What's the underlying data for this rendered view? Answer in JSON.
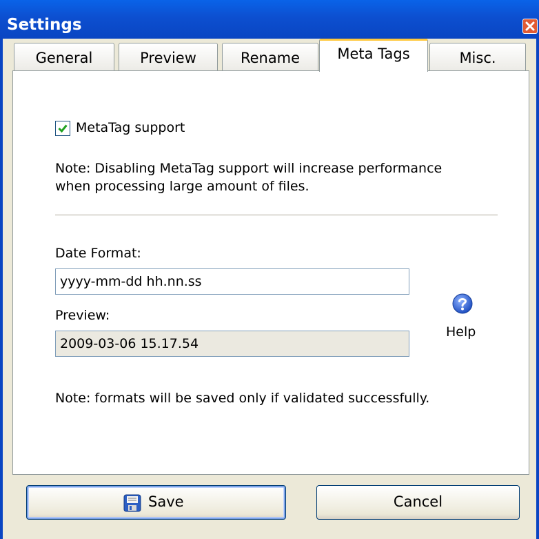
{
  "window": {
    "title": "Settings"
  },
  "tabs": [
    {
      "label": "General"
    },
    {
      "label": "Preview"
    },
    {
      "label": "Rename"
    },
    {
      "label": "Meta Tags"
    },
    {
      "label": "Misc."
    }
  ],
  "active_tab": "Meta Tags",
  "metatag": {
    "checkbox_label": "MetaTag support",
    "checked": true,
    "note_line1": "Note: Disabling MetaTag support will increase performance",
    "note_line2": "when processing large amount of files."
  },
  "date_format": {
    "label": "Date Format:",
    "value": "yyyy-mm-dd hh.nn.ss",
    "preview_label": "Preview:",
    "preview_value": "2009-03-06 15.17.54",
    "help_label": "Help",
    "note": "Note: formats will be saved only if validated successfully."
  },
  "buttons": {
    "save": "Save",
    "cancel": "Cancel"
  },
  "icons": {
    "close": "close-icon",
    "check": "checkmark-icon",
    "help": "help-icon",
    "save": "save-disk-icon"
  },
  "colors": {
    "titlebar": "#0c4fd0",
    "active_tab_accent": "#ffc83c",
    "checkmark": "#21a121",
    "help_blue": "#2a63d6"
  }
}
